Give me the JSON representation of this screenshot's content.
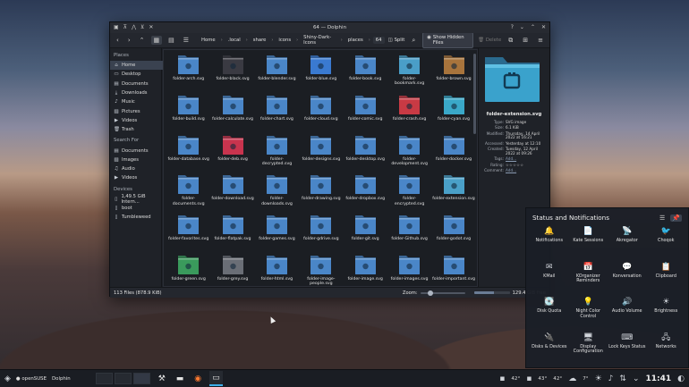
{
  "window": {
    "title": "64 — Dolphin",
    "titlebar_left_icons": [
      "app-icon",
      "pin-icon",
      "keep-above-icon",
      "shade-icon",
      "close-alt-icon"
    ],
    "titlebar_right_icons": [
      "help-icon",
      "minimize-icon",
      "maximize-icon",
      "close-icon"
    ]
  },
  "toolbar": {
    "breadcrumbs": [
      "Home",
      ".local",
      "share",
      "icons",
      "Shiny-Dark-Icons",
      "places",
      "64"
    ],
    "split_label": "Split",
    "search_icon": "search-icon",
    "hidden_label": "Show Hidden Files",
    "delete_label": "Delete"
  },
  "sidebar": {
    "places_heading": "Places",
    "places": [
      {
        "label": "Home",
        "icon": "home-icon",
        "selected": true
      },
      {
        "label": "Desktop",
        "icon": "desktop-icon",
        "selected": false
      },
      {
        "label": "Documents",
        "icon": "documents-icon",
        "selected": false
      },
      {
        "label": "Downloads",
        "icon": "downloads-icon",
        "selected": false
      },
      {
        "label": "Music",
        "icon": "music-icon",
        "selected": false
      },
      {
        "label": "Pictures",
        "icon": "pictures-icon",
        "selected": false
      },
      {
        "label": "Videos",
        "icon": "videos-icon",
        "selected": false
      },
      {
        "label": "Trash",
        "icon": "trash-icon",
        "selected": false
      }
    ],
    "search_heading": "Search For",
    "search": [
      {
        "label": "Documents",
        "icon": "documents-icon"
      },
      {
        "label": "Images",
        "icon": "images-icon"
      },
      {
        "label": "Audio",
        "icon": "audio-icon"
      },
      {
        "label": "Videos",
        "icon": "videos-icon"
      }
    ],
    "devices_heading": "Devices",
    "devices": [
      {
        "label": "1,49.5 GiB Intern...",
        "icon": "drive-icon"
      },
      {
        "label": "boot",
        "icon": "drive-icon"
      },
      {
        "label": "Tumbleweed",
        "icon": "drive-icon"
      }
    ]
  },
  "files": [
    {
      "name": "folder-arch.svg",
      "color": "#4a86c8"
    },
    {
      "name": "folder-black.svg",
      "color": "#3a3a42"
    },
    {
      "name": "folder-blender.svg",
      "color": "#4a86c8"
    },
    {
      "name": "folder-blue.svg",
      "color": "#3a7ad0"
    },
    {
      "name": "folder-book.svg",
      "color": "#4a86c8"
    },
    {
      "name": "folder-bookmark.svg",
      "color": "#4a9ec8"
    },
    {
      "name": "folder-brown.svg",
      "color": "#a8743c"
    },
    {
      "name": "folder-build.svg",
      "color": "#4a86c8"
    },
    {
      "name": "folder-calculate.svg",
      "color": "#4a86c8"
    },
    {
      "name": "folder-chart.svg",
      "color": "#4a86c8"
    },
    {
      "name": "folder-cloud.svg",
      "color": "#4a86c8"
    },
    {
      "name": "folder-comic.svg",
      "color": "#4a86c8"
    },
    {
      "name": "folder-crash.svg",
      "color": "#c83a44"
    },
    {
      "name": "folder-cyan.svg",
      "color": "#3aa8c8"
    },
    {
      "name": "folder-database.svg",
      "color": "#4a86c8"
    },
    {
      "name": "folder-deb.svg",
      "color": "#c8344e"
    },
    {
      "name": "folder-decrypted.svg",
      "color": "#4a86c8"
    },
    {
      "name": "folder-designs.svg",
      "color": "#4a86c8"
    },
    {
      "name": "folder-desktop.svg",
      "color": "#4a86c8"
    },
    {
      "name": "folder-development.svg",
      "color": "#4a86c8"
    },
    {
      "name": "folder-docker.svg",
      "color": "#4a86c8"
    },
    {
      "name": "folder-documents.svg",
      "color": "#4a86c8"
    },
    {
      "name": "folder-download.svg",
      "color": "#4a86c8"
    },
    {
      "name": "folder-downloads.svg",
      "color": "#4a86c8"
    },
    {
      "name": "folder-drawing.svg",
      "color": "#4a86c8"
    },
    {
      "name": "folder-dropbox.svg",
      "color": "#4a86c8"
    },
    {
      "name": "folder-encrypted.svg",
      "color": "#4a86c8"
    },
    {
      "name": "folder-extension.svg",
      "color": "#4aa0c8"
    },
    {
      "name": "folder-favorites.svg",
      "color": "#4a86c8"
    },
    {
      "name": "folder-flatpak.svg",
      "color": "#4a86c8"
    },
    {
      "name": "folder-games.svg",
      "color": "#4a86c8"
    },
    {
      "name": "folder-gdrive.svg",
      "color": "#4a86c8"
    },
    {
      "name": "folder-git.svg",
      "color": "#4a86c8"
    },
    {
      "name": "folder-Github.svg",
      "color": "#4a86c8"
    },
    {
      "name": "folder-godot.svg",
      "color": "#4a86c8"
    },
    {
      "name": "folder-green.svg",
      "color": "#3a9a5c"
    },
    {
      "name": "folder-grey.svg",
      "color": "#6a6e76"
    },
    {
      "name": "folder-html.svg",
      "color": "#4a86c8"
    },
    {
      "name": "folder-image-people.svg",
      "color": "#4a86c8"
    },
    {
      "name": "folder-image.svg",
      "color": "#4a86c8"
    },
    {
      "name": "folder-images.svg",
      "color": "#4a86c8"
    },
    {
      "name": "folder-important.svg",
      "color": "#4a86c8"
    }
  ],
  "info_panel": {
    "name": "folder-extension.svg",
    "rows": [
      {
        "key": "Type:",
        "value": "SVG image",
        "link": false
      },
      {
        "key": "Size:",
        "value": "6.1 KiB",
        "link": false
      },
      {
        "key": "Modified:",
        "value": "Thursday, 14 April 2022 at 16:21",
        "link": false
      },
      {
        "key": "Accessed:",
        "value": "Yesterday at 12:10",
        "link": false
      },
      {
        "key": "Created:",
        "value": "Tuesday, 12 April 2022 at 09:26",
        "link": false
      },
      {
        "key": "Tags:",
        "value": "Add...",
        "link": true
      },
      {
        "key": "Rating:",
        "value": "☆☆☆☆☆",
        "link": false
      },
      {
        "key": "Comment:",
        "value": "Add...",
        "link": true
      }
    ]
  },
  "statusbar": {
    "count": "113 Files (878.9 KiB)",
    "zoom_label": "Zoom:",
    "zoom_level": 0.2,
    "free": "129.4 GiB free",
    "used_fraction": 0.55
  },
  "tray": {
    "title": "Status and Notifications",
    "items": [
      {
        "label": "Notifications",
        "icon": "bell-icon",
        "glyph": "🔔"
      },
      {
        "label": "Kate Sessions",
        "icon": "kate-icon",
        "glyph": "📄"
      },
      {
        "label": "Akregator",
        "icon": "rss-icon",
        "glyph": "📡"
      },
      {
        "label": "Choqok",
        "icon": "choqok-icon",
        "glyph": "🐦"
      },
      {
        "label": "KMail",
        "icon": "mail-icon",
        "glyph": "✉"
      },
      {
        "label": "KOrganizer Reminders",
        "icon": "calendar-icon",
        "glyph": "📅"
      },
      {
        "label": "Konversation",
        "icon": "chat-icon",
        "glyph": "💬"
      },
      {
        "label": "Clipboard",
        "icon": "clipboard-icon",
        "glyph": "📋"
      },
      {
        "label": "Disk Quota",
        "icon": "disk-icon",
        "glyph": "💽"
      },
      {
        "label": "Night Color Control",
        "icon": "lightbulb-icon",
        "glyph": "💡"
      },
      {
        "label": "Audio Volume",
        "icon": "speaker-icon",
        "glyph": "🔊"
      },
      {
        "label": "Brightness",
        "icon": "sun-icon",
        "glyph": "☀"
      },
      {
        "label": "Disks & Devices",
        "icon": "usb-icon",
        "glyph": "🔌"
      },
      {
        "label": "Display Configuration",
        "icon": "monitor-icon",
        "glyph": "🖥"
      },
      {
        "label": "Lock Keys Status",
        "icon": "keyboard-icon",
        "glyph": "⌨"
      },
      {
        "label": "Networks",
        "icon": "network-icon",
        "glyph": "🖧"
      }
    ]
  },
  "taskbar": {
    "distro": "openSUSE",
    "app": "Dolphin",
    "temps": [
      "42°",
      "43°",
      "42°"
    ],
    "weather": "7°",
    "clock": "11:41"
  }
}
